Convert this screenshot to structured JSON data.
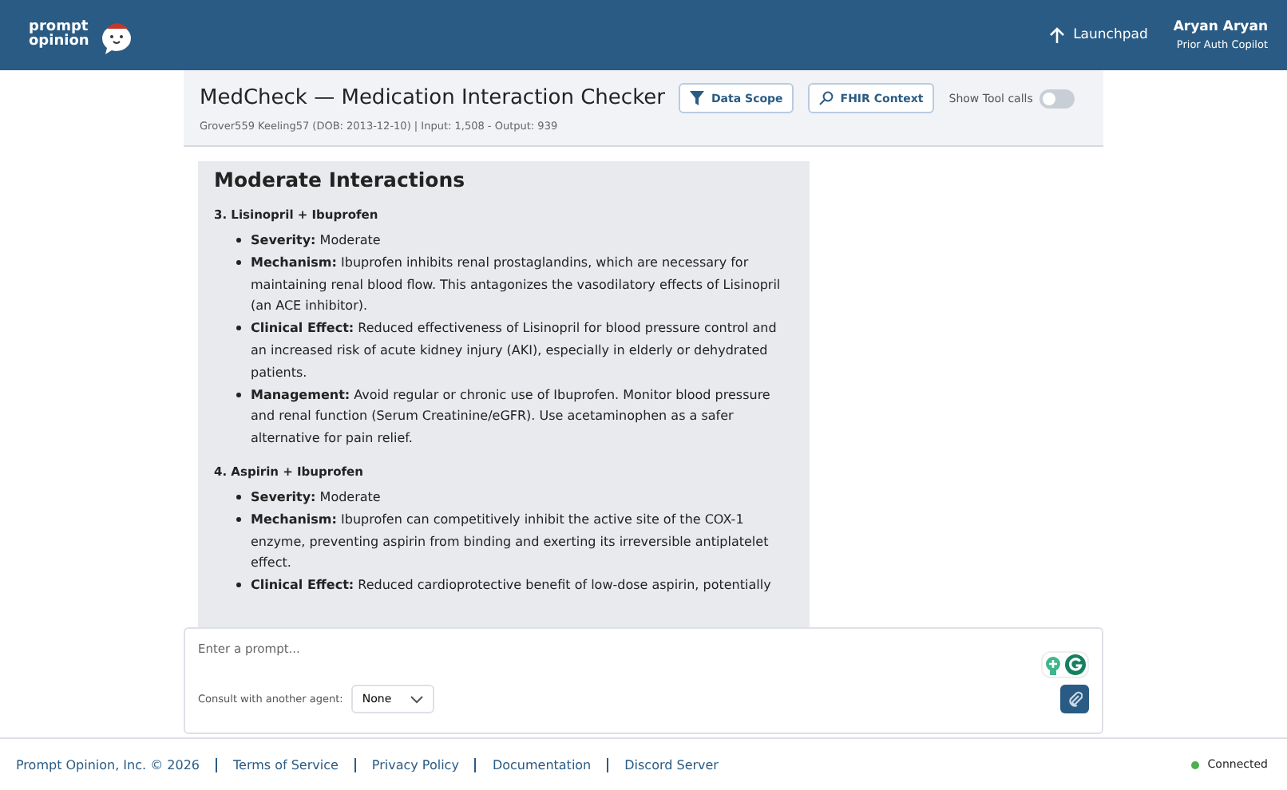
{
  "header": {
    "logo_line1": "prompt",
    "logo_line2": "opinion",
    "launchpad": "Launchpad",
    "user_name": "Aryan Aryan",
    "user_role": "Prior Auth Copilot"
  },
  "title_card": {
    "title": "MedCheck — Medication Interaction Checker",
    "subtitle": "Grover559 Keeling57 (DOB: 2013-12-10)  | Input: 1,508 - Output: 939",
    "data_scope": "Data Scope",
    "fhir_context": "FHIR Context",
    "tool_calls": {
      "label": "Show Tool calls",
      "on": false
    }
  },
  "message": {
    "heading": "Moderate Interactions",
    "sections": [
      {
        "title": "3. Lisinopril + Ibuprofen",
        "bullets": [
          "**Severity:** Moderate",
          "**Mechanism:** Ibuprofen inhibits renal prostaglandins, which are necessary for maintaining renal blood flow. This antagonizes the vasodilatory effects of Lisinopril (an ACE inhibitor).",
          "**Clinical Effect:** Reduced effectiveness of Lisinopril for blood pressure control and an increased risk of acute kidney injury (AKI), especially in elderly or dehydrated patients.",
          "**Management:** Avoid regular or chronic use of Ibuprofen. Monitor blood pressure and renal function (Serum Creatinine/eGFR). Use acetaminophen as a safer alternative for pain relief."
        ]
      },
      {
        "title": "4. Aspirin + Ibuprofen",
        "bullets": [
          "**Severity:** Moderate",
          "**Mechanism:** Ibuprofen can competitively inhibit the active site of the COX-1 enzyme, preventing aspirin from binding and exerting its irreversible antiplatelet effect.",
          "**Clinical Effect:** Reduced cardioprotective benefit of low-dose aspirin, potentially"
        ]
      }
    ]
  },
  "prompt": {
    "placeholder": "Enter a prompt...",
    "consult_label": "Consult with another agent:",
    "agent": "None"
  },
  "footer": {
    "links": [
      "Prompt Opinion, Inc. © 2026",
      "Terms of Service",
      "Privacy Policy",
      "Documentation",
      "Discord Server"
    ],
    "status": {
      "label": "Connected",
      "color": "#4caf50"
    }
  }
}
